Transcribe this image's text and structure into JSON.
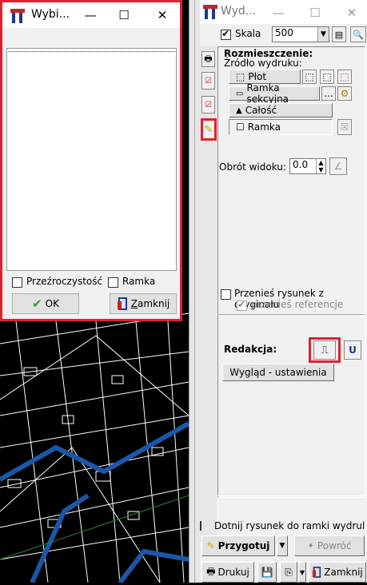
{
  "dialog": {
    "title": "Wybi...",
    "controls": {
      "minimize": "—",
      "maximize": "☐",
      "close": "✕"
    },
    "transparency_label": "Przeźroczystość",
    "transparency_checked": false,
    "frame_label": "Ramka",
    "frame_checked": false,
    "ok_label": "OK",
    "close_label": "Zamknij",
    "close_hotkey": "Z",
    "close_rest": "amknij"
  },
  "panel": {
    "title": "Wyd...",
    "controls": {
      "minimize": "—",
      "maximize": "☐",
      "close": "✕"
    },
    "scale_label": "Skala",
    "scale_checked": true,
    "scale_value": "500",
    "placement_heading": "Rozmieszczenie:",
    "source_group_label": "Źródło wydruku:",
    "source_options": [
      "Płot",
      "Ramka sekcyjna",
      "Całość",
      "Ramka"
    ],
    "ellipsis": "...",
    "rotation_label": "Obrót widoku:",
    "rotation_value": "0.0",
    "transfer_label": "Przenieś rysunek z oryginału",
    "transfer_checked": false,
    "transfer_refs_label": "przenieś referencje",
    "transfer_refs_checked": true,
    "editing_label": "Redakcja:",
    "u_button": "U",
    "appearance_button": "Wygląd - ustawienia",
    "trim_label": "Dotnij rysunek do ramki wydrul",
    "prepare_button": "Przygotuj",
    "back_button": "Powróć",
    "print_button": "Drukuj",
    "close_button": "Zamknij"
  },
  "colors": {
    "highlight": "#e0202c",
    "accent": "#1b57a8"
  }
}
